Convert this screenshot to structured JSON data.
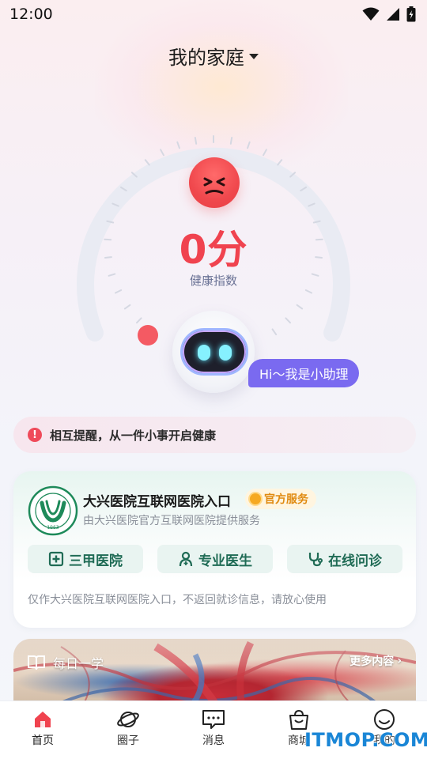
{
  "status_bar": {
    "time": "12:00",
    "icons": [
      "wifi-icon",
      "signal-icon",
      "battery-icon"
    ]
  },
  "header": {
    "title": "我的家庭",
    "dropdown_icon": "caret-down-icon"
  },
  "health": {
    "score": "0分",
    "label": "健康指数",
    "mood_icon": "angry-face-icon",
    "level_fraction": 0,
    "gauge_color": "#e9ebf3",
    "score_color": "#f0434f"
  },
  "assistant": {
    "greeting": "Hi～我是小助理"
  },
  "reminder": {
    "icon": "exclamation-icon",
    "text": "相互提醒，从一件小事开启健康"
  },
  "hospital": {
    "name": "大兴医院互联网医院入口",
    "badge": "官方服务",
    "subtitle": "由大兴医院官方互联网医院提供服务",
    "logo_year": "1963",
    "features": [
      {
        "icon": "hospital-cross-icon",
        "label": "三甲医院"
      },
      {
        "icon": "doctor-icon",
        "label": "专业医生"
      },
      {
        "icon": "stethoscope-icon",
        "label": "在线问诊"
      }
    ],
    "note": "仅作大兴医院互联网医院入口，不返回就诊信息，请放心使用"
  },
  "daily_learn": {
    "icon": "book-icon",
    "label": "每日一学",
    "more": "更多内容"
  },
  "tabbar": {
    "items": [
      {
        "icon": "home-icon",
        "label": "首页",
        "active": true
      },
      {
        "icon": "planet-icon",
        "label": "圈子",
        "active": false
      },
      {
        "icon": "message-icon",
        "label": "消息",
        "active": false
      },
      {
        "icon": "shopping-bag-icon",
        "label": "商城",
        "active": false
      },
      {
        "icon": "smile-icon",
        "label": "我的",
        "active": false
      }
    ]
  },
  "watermark": {
    "text": "ITMOP.COM"
  },
  "colors": {
    "accent": "#f0434f",
    "assistant": "#7a6af0",
    "hospital_green": "#1f6b55",
    "active_tab": "#f0434f"
  }
}
